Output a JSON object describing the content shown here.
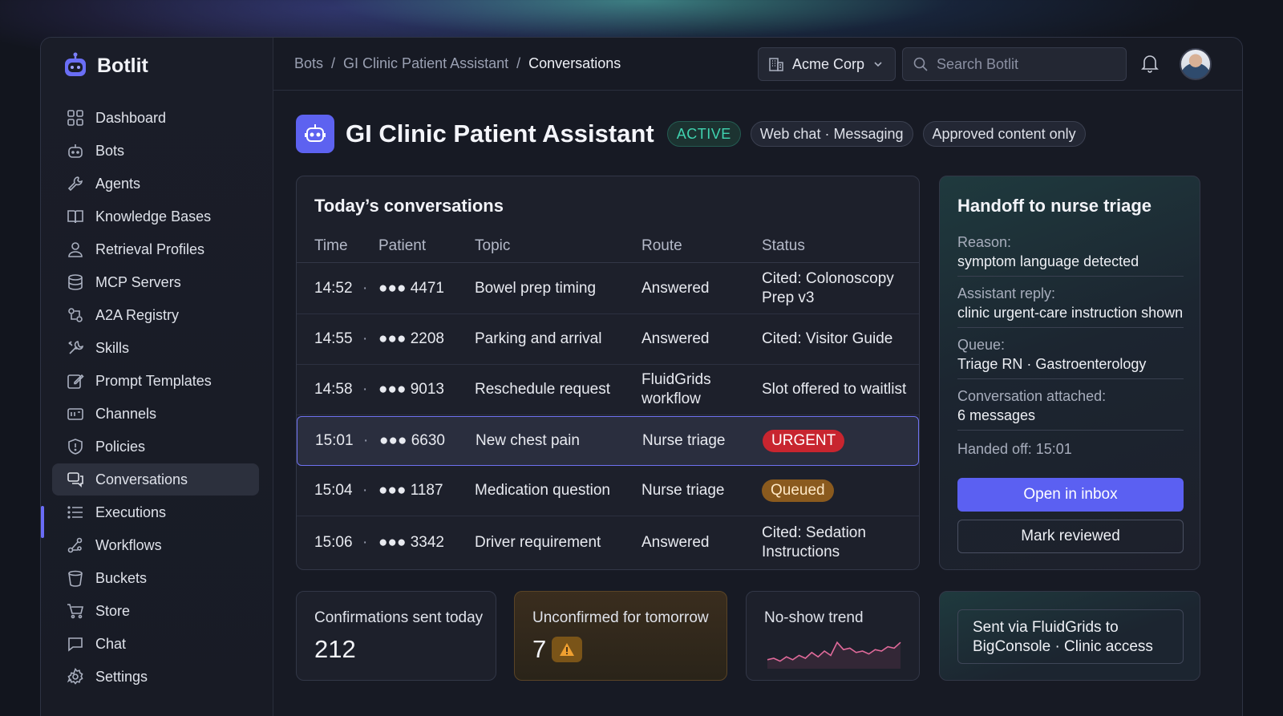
{
  "app": {
    "name": "Botlit"
  },
  "sidebar": {
    "items": [
      {
        "label": "Dashboard",
        "icon": "grid-icon"
      },
      {
        "label": "Bots",
        "icon": "bot-icon"
      },
      {
        "label": "Agents",
        "icon": "wrench-icon"
      },
      {
        "label": "Knowledge Bases",
        "icon": "book-icon"
      },
      {
        "label": "Retrieval Profiles",
        "icon": "user-icon"
      },
      {
        "label": "MCP Servers",
        "icon": "database-icon"
      },
      {
        "label": "A2A Registry",
        "icon": "exchange-icon"
      },
      {
        "label": "Skills",
        "icon": "tools-icon"
      },
      {
        "label": "Prompt Templates",
        "icon": "edit-icon"
      },
      {
        "label": "Channels",
        "icon": "channels-icon"
      },
      {
        "label": "Policies",
        "icon": "shield-icon"
      },
      {
        "label": "Conversations",
        "icon": "chat-bubbles-icon",
        "active": true
      },
      {
        "label": "Executions",
        "icon": "list-icon"
      },
      {
        "label": "Workflows",
        "icon": "workflow-icon"
      },
      {
        "label": "Buckets",
        "icon": "bucket-icon"
      },
      {
        "label": "Store",
        "icon": "cart-icon"
      },
      {
        "label": "Chat",
        "icon": "message-icon"
      },
      {
        "label": "Settings",
        "icon": "gear-icon"
      }
    ]
  },
  "header": {
    "breadcrumb": [
      "Bots",
      "GI Clinic Patient Assistant",
      "Conversations"
    ],
    "separator": "/",
    "org": "Acme Corp",
    "search_placeholder": "Search Botlit"
  },
  "page": {
    "title": "GI Clinic Patient Assistant",
    "status": "ACTIVE",
    "tags": [
      "Web chat · Messaging",
      "Approved content only"
    ]
  },
  "conversations": {
    "title": "Today’s conversations",
    "columns": [
      "Time",
      "Patient",
      "Topic",
      "Route",
      "Status"
    ],
    "rows": [
      {
        "time": "14:52",
        "dot": "·",
        "patient": "●●● 4471",
        "topic": "Bowel prep timing",
        "route": "Answered",
        "status": "Cited: Colonoscopy Prep v3",
        "status_type": "text"
      },
      {
        "time": "14:55",
        "dot": "·",
        "patient": "●●● 2208",
        "topic": "Parking and arrival",
        "route": "Answered",
        "status": "Cited: Visitor Guide",
        "status_type": "text"
      },
      {
        "time": "14:58",
        "dot": "·",
        "patient": "●●● 9013",
        "topic": "Reschedule request",
        "route": "FluidGrids workflow",
        "status": "Slot offered to waitlist",
        "status_type": "text"
      },
      {
        "time": "15:01",
        "dot": "·",
        "patient": "●●● 6630",
        "topic": "New chest pain",
        "route": "Nurse triage",
        "status": "URGENT",
        "status_type": "urgent"
      },
      {
        "time": "15:04",
        "dot": "·",
        "patient": "●●● 1187",
        "topic": "Medication question",
        "route": "Nurse triage",
        "status": "Queued",
        "status_type": "queued"
      },
      {
        "time": "15:06",
        "dot": "·",
        "patient": "●●● 3342",
        "topic": "Driver requirement",
        "route": "Answered",
        "status": "Cited: Sedation Instructions",
        "status_type": "text"
      }
    ]
  },
  "handoff": {
    "title": "Handoff to nurse triage",
    "fields": [
      {
        "key": "Reason:",
        "value": "symptom language detected"
      },
      {
        "key": "Assistant reply:",
        "value": "clinic urgent-care instruction shown"
      },
      {
        "key": "Queue:",
        "value": "Triage RN · Gastroenterology"
      },
      {
        "key": "Conversation attached:",
        "value": "6 messages"
      }
    ],
    "handed_off": "Handed off: 15:01",
    "primary_button": "Open in inbox",
    "secondary_button": "Mark reviewed"
  },
  "stats": {
    "confirmations": {
      "label": "Confirmations sent today",
      "value": "212"
    },
    "unconfirmed": {
      "label": "Unconfirmed for tomorrow",
      "value": "7"
    },
    "noshow": {
      "label": "No-show trend",
      "trend": [
        0.2,
        0.25,
        0.15,
        0.3,
        0.2,
        0.35,
        0.25,
        0.45,
        0.3,
        0.5,
        0.35,
        0.8,
        0.55,
        0.6,
        0.45,
        0.5,
        0.4,
        0.55,
        0.5,
        0.65,
        0.6,
        0.8
      ]
    },
    "sent_via": {
      "line1": "Sent via FluidGrids to",
      "line2": "BigConsole · Clinic access"
    }
  },
  "colors": {
    "accent": "#5b60f2",
    "active": "#40d3b0",
    "urgent": "#c8252f",
    "queued": "#8a5a1e"
  }
}
